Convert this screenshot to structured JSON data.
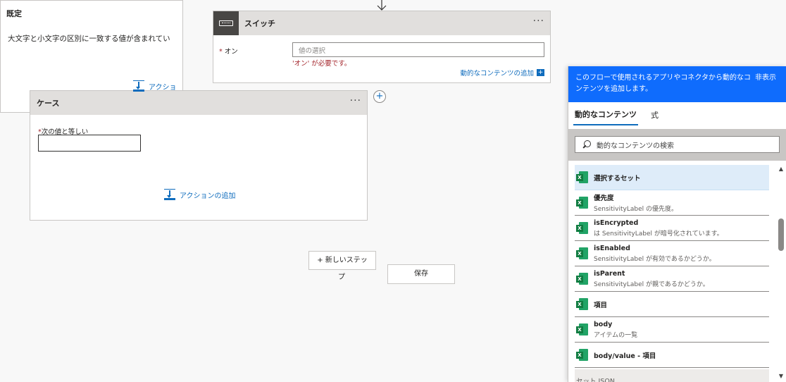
{
  "switch": {
    "title": "スイッチ",
    "more": "···",
    "on_label": "オン",
    "on_placeholder": "値の選択",
    "on_error": "'オン' が必要です。",
    "add_dynamic": "動的なコンテンツの追加",
    "add_dynamic_plus": "+"
  },
  "case": {
    "title": "ケース",
    "more": "···",
    "equals_label": "次の値と等しい",
    "add_action": "アクションの追加"
  },
  "default": {
    "title": "既定",
    "text": "大文字と小文字の区別に一致する値が含まれてい",
    "add_action": "アクショ"
  },
  "required_mark": "*",
  "add_branch": "+",
  "new_step": "+ 新しいステッ",
  "new_step_wrap": "プ",
  "save": "保存",
  "panel": {
    "message": "このフローで使用されるアプリやコネクタから動的なコンテンツを追加します。",
    "hide": "非表示",
    "tabs": [
      "動的なコンテンツ",
      "式"
    ],
    "search_placeholder": "動的なコンテンツの検索",
    "items": [
      {
        "name": "選択するセット",
        "desc": ""
      },
      {
        "name": "優先度",
        "desc": "SensitivityLabel の優先度。"
      },
      {
        "name": "isEncrypted",
        "desc": "は SensitivityLabel が暗号化されています。"
      },
      {
        "name": "isEnabled",
        "desc": "SensitivityLabel が有効であるかどうか。"
      },
      {
        "name": "isParent",
        "desc": "SensitivityLabel が親であるかどうか。"
      },
      {
        "name": "項目",
        "desc": ""
      },
      {
        "name": "body",
        "desc": "アイテムの一覧"
      },
      {
        "name": "body/value - 項目",
        "desc": ""
      }
    ],
    "partial_item": "セット JSON",
    "scroll_up": "▲",
    "scroll_down": "▼",
    "excel_letter": "X"
  },
  "colors": {
    "accent": "#0f6cbd",
    "panel_header": "#0f6cfd",
    "error": "#a4262c",
    "excel": "#107c41"
  }
}
